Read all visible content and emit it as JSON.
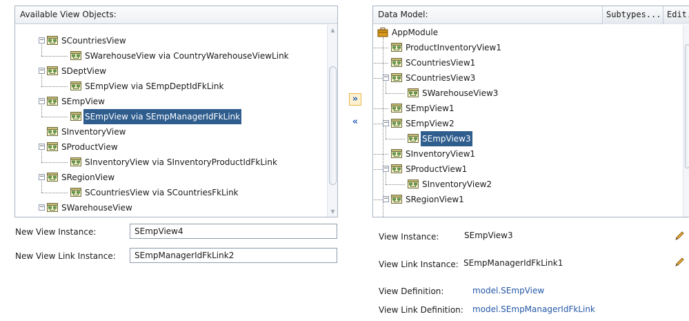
{
  "left": {
    "header": "Available View Objects:",
    "nodes": [
      {
        "label": "SCountriesView",
        "level": 0,
        "toggle": "−"
      },
      {
        "label": "SWarehouseView via CountryWarehouseViewLink",
        "level": 1
      },
      {
        "label": "SDeptView",
        "level": 0,
        "toggle": "−"
      },
      {
        "label": "SEmpView via SEmpDeptIdFkLink",
        "level": 1
      },
      {
        "label": "SEmpView",
        "level": 0,
        "toggle": "−"
      },
      {
        "label": "SEmpView via SEmpManagerIdFkLink",
        "level": 1,
        "selected": true
      },
      {
        "label": "SInventoryView",
        "level": 0
      },
      {
        "label": "SProductView",
        "level": 0,
        "toggle": "−"
      },
      {
        "label": "SInventoryView via SInventoryProductIdFkLink",
        "level": 1
      },
      {
        "label": "SRegionView",
        "level": 0,
        "toggle": "−"
      },
      {
        "label": "SCountriesView via SCountriesFkLink",
        "level": 1
      },
      {
        "label": "SWarehouseView",
        "level": 0,
        "toggle": "−"
      }
    ]
  },
  "form_left": {
    "view_instance_label": "New View Instance:",
    "view_instance_value": "SEmpView4",
    "view_link_label": "New View Link Instance:",
    "view_link_value": "SEmpManagerIdFkLink2"
  },
  "shuttle": {
    "add_icon": "double-chevron-right-icon",
    "remove_icon": "double-chevron-left-icon"
  },
  "right": {
    "header": "Data Model:",
    "subtypes_button": "Subtypes...",
    "edit_button": "Edit...",
    "root": "AppModule",
    "nodes": [
      {
        "label": "ProductInventoryView1",
        "level": 1
      },
      {
        "label": "SCountriesView1",
        "level": 1
      },
      {
        "label": "SCountriesView3",
        "level": 1,
        "toggle": "−"
      },
      {
        "label": "SWarehouseView3",
        "level": 2
      },
      {
        "label": "SEmpView1",
        "level": 1
      },
      {
        "label": "SEmpView2",
        "level": 1,
        "toggle": "−"
      },
      {
        "label": "SEmpView3",
        "level": 2,
        "selected": true
      },
      {
        "label": "SInventoryView1",
        "level": 1
      },
      {
        "label": "SProductView1",
        "level": 1,
        "toggle": "−"
      },
      {
        "label": "SInventoryView2",
        "level": 2
      },
      {
        "label": "SRegionView1",
        "level": 1,
        "toggle": "−"
      }
    ]
  },
  "details": {
    "view_instance_label": "View Instance:",
    "view_instance_value": "SEmpView3",
    "view_link_instance_label": "View Link Instance:",
    "view_link_instance_value": "SEmpManagerIdFkLink1",
    "view_definition_label": "View Definition:",
    "view_definition_value": "model.SEmpView",
    "view_link_definition_label": "View Link Definition:",
    "view_link_definition_value": "model.SEmpManagerIdFkLink"
  },
  "colors": {
    "selection": "#2f5d8e",
    "link": "#2356a6",
    "border": "#a7b4c3"
  }
}
